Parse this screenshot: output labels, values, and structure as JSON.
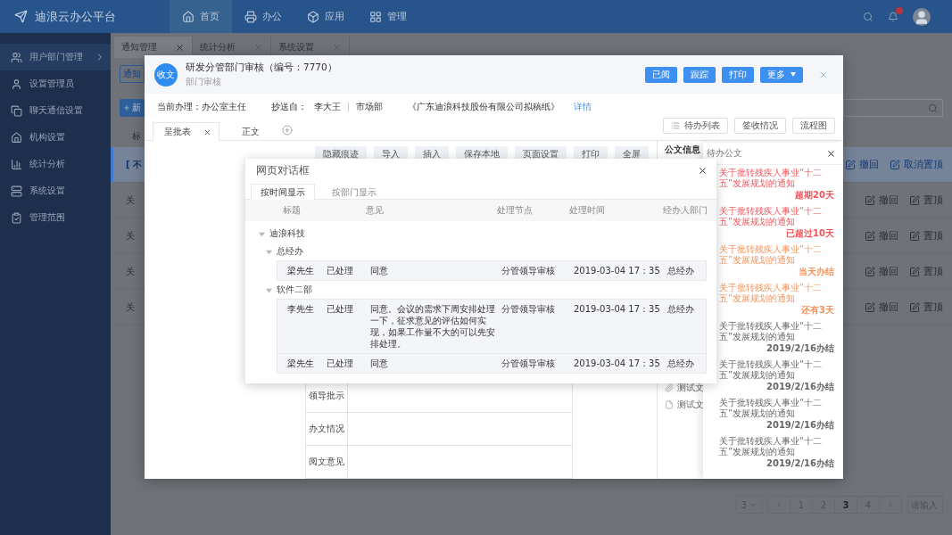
{
  "topbar": {
    "logo": "迪浪云办公平台",
    "nav": [
      {
        "label": "首页",
        "selected": true
      },
      {
        "label": "办公",
        "selected": false
      },
      {
        "label": "应用",
        "selected": false
      },
      {
        "label": "管理",
        "selected": false
      }
    ]
  },
  "sidebar": {
    "items": [
      {
        "label": "用户部门管理",
        "selected": true
      },
      {
        "label": "设置管理员",
        "selected": false
      },
      {
        "label": "聊天通信设置",
        "selected": false
      },
      {
        "label": "机构设置",
        "selected": false
      },
      {
        "label": "统计分析",
        "selected": false
      },
      {
        "label": "系统设置",
        "selected": false
      },
      {
        "label": "管理范围",
        "selected": false
      }
    ]
  },
  "page_tabs": [
    {
      "label": "通知管理",
      "selected": true
    },
    {
      "label": "统计分析",
      "selected": false
    },
    {
      "label": "系统设置",
      "selected": false
    }
  ],
  "list": {
    "filter_button": "通知",
    "new_button": "新",
    "column_1": "标",
    "rows": [
      {
        "title": "[ 不",
        "selected": true,
        "actions": [
          "撤回",
          "取消置顶"
        ]
      },
      {
        "title": "关",
        "selected": false,
        "actions": [
          "撤回",
          "置顶"
        ]
      },
      {
        "title": "关",
        "selected": false,
        "actions": [
          "撤回",
          "置顶"
        ]
      },
      {
        "title": "关",
        "selected": false,
        "actions": [
          "撤回",
          "置顶"
        ]
      },
      {
        "title": "关",
        "selected": false,
        "actions": [
          "撤回",
          "置顶"
        ]
      }
    ]
  },
  "pagination": {
    "page_size": "3",
    "pages": [
      {
        "label": "1",
        "selected": false
      },
      {
        "label": "2",
        "selected": false
      },
      {
        "label": "3",
        "selected": true
      },
      {
        "label": "4",
        "selected": false
      }
    ],
    "jump_placeholder": "请输入"
  },
  "modal": {
    "avatar": "收文",
    "title": "研发分管部门审核（编号：7770）",
    "subtitle": "部门审核",
    "actions": [
      "已阅",
      "跟踪",
      "打印",
      "更多"
    ],
    "info": {
      "current": "当前办理：办公室主任",
      "cc_label": "抄送自：",
      "cc_person": "李大王",
      "cc_dept": "市场部",
      "document": "《广东迪浪科技股份有限公司拟稿纸》",
      "link": "详情"
    },
    "tabs": [
      {
        "label": "呈批表",
        "selected": true
      },
      {
        "label": "正文",
        "selected": false
      }
    ],
    "side_buttons": [
      "待办列表",
      "签收情况",
      "流程图"
    ],
    "doc_toolbar": [
      "隐藏痕迹",
      "导入",
      "插入",
      "保存本地",
      "页面设置",
      "打印",
      "全屏"
    ],
    "form_rows": [
      "领导批示",
      "办文情况",
      "阅文意见"
    ],
    "info_panel": {
      "title": "公文信息",
      "attachments": [
        {
          "kind": "link",
          "name": "测试文"
        },
        {
          "kind": "file",
          "name": "测试文"
        }
      ]
    }
  },
  "dialog": {
    "title": "网页对话框",
    "tabs": [
      {
        "label": "按时间显示",
        "selected": true
      },
      {
        "label": "按部门显示",
        "selected": false
      }
    ],
    "columns": [
      "标题",
      "意见",
      "处理节点",
      "处理时间",
      "经办人部门"
    ],
    "tree": [
      {
        "label": "迪浪科技",
        "expanded": true,
        "children": [
          {
            "label": "总经办",
            "expanded": true,
            "records": [
              {
                "person": "梁先生",
                "status": "已处理",
                "opinion": "同意",
                "node": "分管领导审核",
                "time": "2019-03-04 17：35",
                "dept": "总经办"
              }
            ]
          },
          {
            "label": "软件二部",
            "expanded": true,
            "records": [
              {
                "person": "李先生",
                "status": "已处理",
                "opinion": "同意。会议的需求下周安排处理一下，征求意见的评估如何实现，如果工作量不大的可以先安排处理。",
                "node": "分管领导审核",
                "time": "2019-03-04 17：35",
                "dept": "总经办"
              },
              {
                "person": "梁先生",
                "status": "已处理",
                "opinion": "同意",
                "node": "分管领导审核",
                "time": "2019-03-04 17：35",
                "dept": "总经办"
              }
            ]
          }
        ]
      }
    ]
  },
  "pending": {
    "title": "待办公文",
    "items": [
      {
        "title": "关于批转残疾人事业“十二五”发展规划的通知",
        "status": "超期20天",
        "color": "#f2545b"
      },
      {
        "title": "关于批转残疾人事业“十二五”发展规划的通知",
        "status": "已超过10天",
        "color": "#f2545b"
      },
      {
        "title": "关于批转残疾人事业“十二五”发展规划的通知",
        "status": "当天办结",
        "color": "#f5935a"
      },
      {
        "title": "关于批转残疾人事业“十二五”发展规划的通知",
        "status": "还有3天",
        "color": "#f5935a"
      },
      {
        "title": "关于批转残疾人事业“十二五”发展规划的通知",
        "status": "2019/2/16办结",
        "color": "#666666"
      },
      {
        "title": "关于批转残疾人事业“十二五”发展规划的通知",
        "status": "2019/2/16办结",
        "color": "#666666"
      },
      {
        "title": "关于批转残疾人事业“十二五”发展规划的通知",
        "status": "2019/2/16办结",
        "color": "#666666"
      },
      {
        "title": "关于批转残疾人事业“十二五”发展规划的通知",
        "status": "2019/2/16办结",
        "color": "#666666"
      }
    ]
  }
}
